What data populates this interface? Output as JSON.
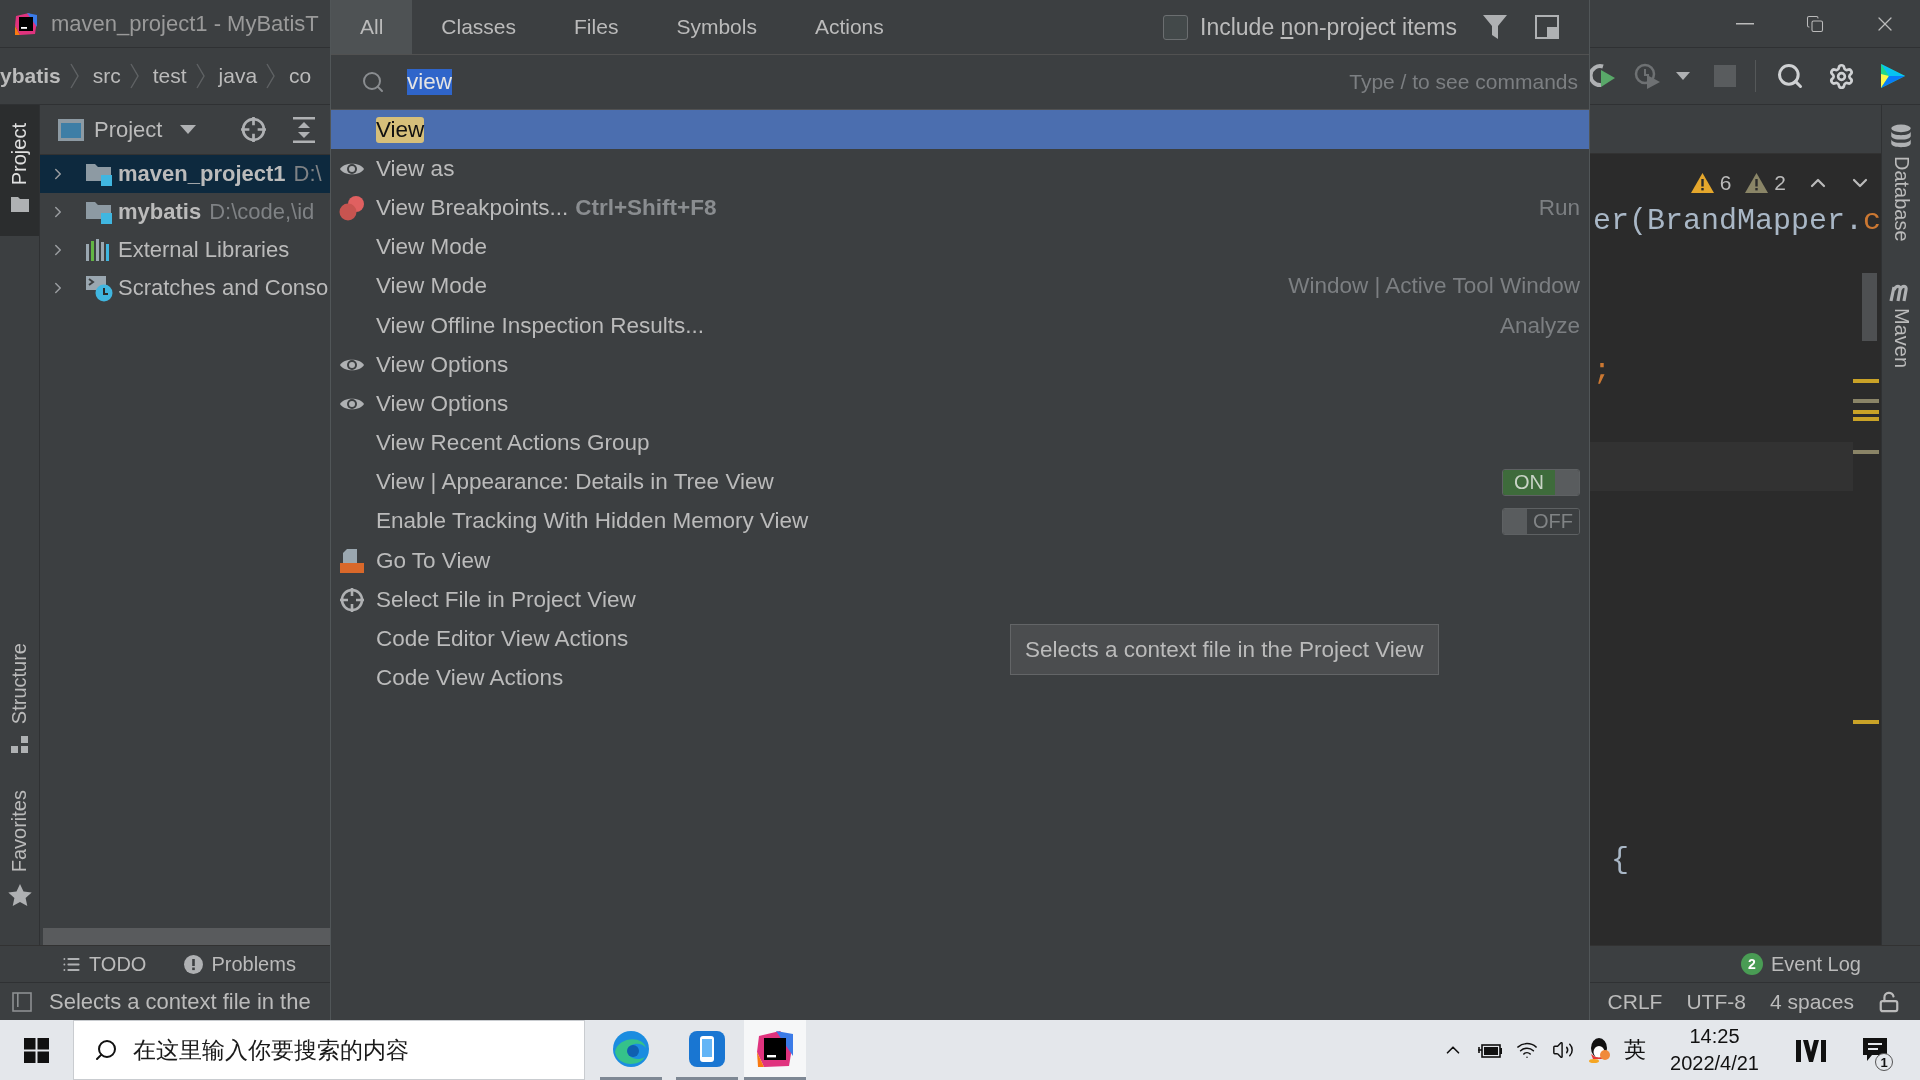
{
  "window": {
    "title": "maven_project1 - MyBatisT"
  },
  "breadcrumbs": [
    {
      "label": "ybatis",
      "kind": "module"
    },
    {
      "label": "src",
      "kind": "folder"
    },
    {
      "label": "test",
      "kind": "folder"
    },
    {
      "label": "java",
      "kind": "folder"
    },
    {
      "label": "co",
      "kind": "folder"
    }
  ],
  "left_stripe": [
    {
      "label": "Project",
      "kind": "project",
      "selected": true
    },
    {
      "label": "Structure",
      "kind": "structure",
      "selected": false
    },
    {
      "label": "Favorites",
      "kind": "favorites",
      "selected": false
    }
  ],
  "project_panel": {
    "title": "Project",
    "tree": [
      {
        "label": "maven_project1",
        "path": "D:\\",
        "kind": "module",
        "selected": true,
        "expanded": false
      },
      {
        "label": "mybatis",
        "path": "D:\\code,\\id",
        "kind": "module",
        "selected": false,
        "expanded": false
      },
      {
        "label": "External Libraries",
        "kind": "libraries",
        "selected": false,
        "expanded": false
      },
      {
        "label": "Scratches and Conso",
        "kind": "scratches",
        "selected": false,
        "expanded": false
      }
    ]
  },
  "editor": {
    "warnings": "6",
    "weak_warnings": "2",
    "lines": [
      {
        "tokens": [
          {
            "text": "er(BrandMapper.",
            "kind": "plain"
          },
          {
            "text": "c",
            "kind": "keyword"
          }
        ]
      },
      {
        "tokens": [
          {
            "text": ";",
            "kind": "keyword"
          }
        ]
      },
      {
        "tokens": [
          {
            "text": "{",
            "kind": "plain"
          }
        ]
      }
    ]
  },
  "right_stripe": [
    {
      "label": "Database",
      "kind": "database"
    },
    {
      "label": "Maven",
      "kind": "maven"
    }
  ],
  "tool_window_bar": {
    "tabs": [
      {
        "label": "TODO",
        "kind": "todo"
      },
      {
        "label": "Problems",
        "kind": "problems"
      }
    ],
    "event_log": {
      "count": "2",
      "label": "Event Log"
    }
  },
  "status_bar": {
    "message": "Selects a context file in the",
    "items": [
      "CRLF",
      "UTF-8",
      "4 spaces"
    ]
  },
  "popup": {
    "tabs": [
      {
        "label": "All",
        "selected": true
      },
      {
        "label": "Classes",
        "selected": false
      },
      {
        "label": "Files",
        "selected": false
      },
      {
        "label": "Symbols",
        "selected": false
      },
      {
        "label": "Actions",
        "selected": false
      }
    ],
    "include_non_project": {
      "label": "Include ",
      "mnemonic": "n",
      "label_rest": "on-project items",
      "checked": false
    },
    "search": {
      "value": "view",
      "hint": "Type / to see commands"
    },
    "results": [
      {
        "label": "View",
        "kind": "plain",
        "selected": true
      },
      {
        "label": "View as",
        "kind": "eye",
        "selected": false
      },
      {
        "label": "View Breakpoints...",
        "kind": "breakpoints",
        "shortcut": "Ctrl+Shift+F8",
        "category": "Run",
        "selected": false
      },
      {
        "label": "View Mode",
        "kind": "plain",
        "selected": false
      },
      {
        "label": "View Mode",
        "kind": "plain",
        "category": "Window | Active Tool Window",
        "selected": false
      },
      {
        "label": "View Offline Inspection Results...",
        "kind": "plain",
        "category": "Analyze",
        "selected": false
      },
      {
        "label": "View Options",
        "kind": "eye",
        "selected": false
      },
      {
        "label": "View Options",
        "kind": "eye",
        "selected": false
      },
      {
        "label": "View Recent Actions Group",
        "kind": "plain",
        "selected": false
      },
      {
        "label": "View | Appearance: Details in Tree View",
        "kind": "plain",
        "switch": {
          "on": true,
          "label": "ON"
        },
        "selected": false
      },
      {
        "label": "Enable Tracking With Hidden Memory View",
        "kind": "plain",
        "switch": {
          "on": false,
          "label": "OFF"
        },
        "selected": false
      },
      {
        "label": "Go To View",
        "kind": "gsp",
        "selected": false
      },
      {
        "label": "Select File in Project View",
        "kind": "locate",
        "selected": false
      },
      {
        "label": "Code Editor View Actions",
        "kind": "plain",
        "selected": false
      },
      {
        "label": "Code View Actions",
        "kind": "plain",
        "selected": false
      }
    ],
    "tooltip": "Selects a context file in the Project View"
  },
  "taskbar": {
    "search_placeholder": "在这里输入你要搜索的内容",
    "apps": [
      {
        "kind": "browser",
        "selected": false
      },
      {
        "kind": "phone",
        "selected": false
      },
      {
        "kind": "ide",
        "selected": true
      }
    ],
    "input_method": "英",
    "time": "14:25",
    "date": "2022/4/21",
    "notifications": "1"
  }
}
